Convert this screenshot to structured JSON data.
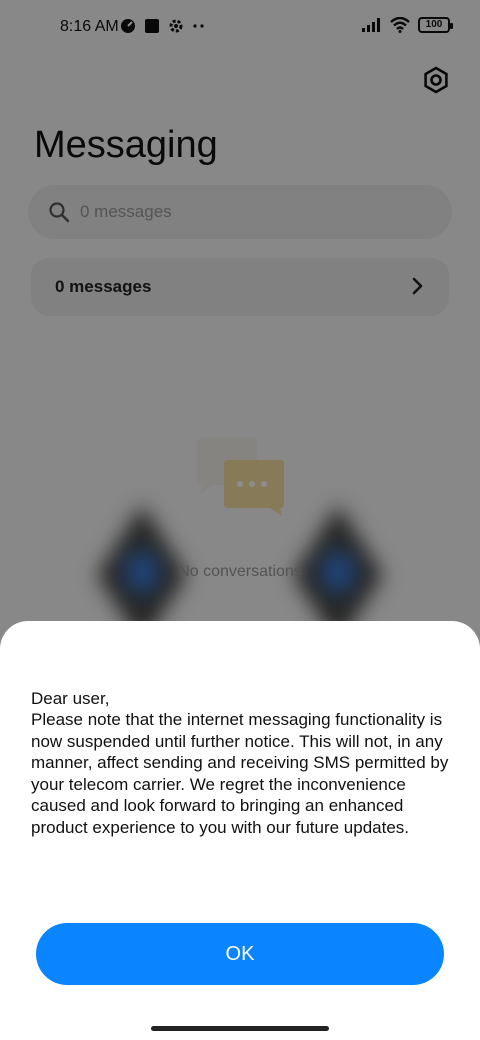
{
  "status_bar": {
    "time": "8:16 AM",
    "battery": "100"
  },
  "app": {
    "title": "Messaging",
    "search": {
      "placeholder": "0 messages"
    },
    "messages_card": {
      "label": "0 messages"
    },
    "empty_state": {
      "text": "No conversations"
    }
  },
  "dialog": {
    "greeting": "Dear user,",
    "message": "Please note that the internet messaging functionality is now suspended until further notice. This will not, in any manner, affect sending and receiving SMS permitted by your telecom carrier. We regret the inconvenience caused and look forward to bringing an enhanced product experience to you with our future updates.",
    "ok_label": "OK"
  },
  "colors": {
    "accent": "#0a84ff",
    "scrim": "rgba(0,0,0,0.45)"
  }
}
